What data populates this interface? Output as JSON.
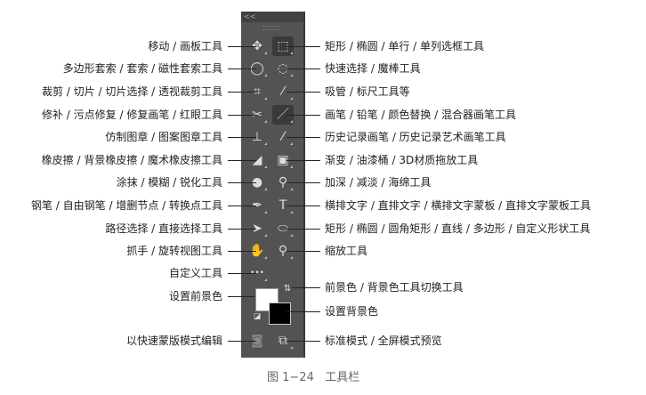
{
  "left_labels": [
    "移动 / 画板工具",
    "多边形套索 / 套索 / 磁性套索工具",
    "裁剪 / 切片 / 切片选择 / 透视裁剪工具",
    "修补 / 污点修复 / 修复画笔 / 红眼工具",
    "仿制图章 / 图案图章工具",
    "橡皮擦 / 背景橡皮擦 / 魔术橡皮擦工具",
    "涂抹 / 模糊 / 锐化工具",
    "钢笔 / 自由钢笔 / 增删节点 / 转换点工具",
    "路径选择 / 直接选择工具",
    "抓手 / 旋转视图工具",
    "自定义工具",
    "设置前景色",
    "以快速蒙版模式编辑"
  ],
  "right_labels": [
    "矩形 / 椭圆 / 单行 / 单列选框工具",
    "快速选择 / 魔棒工具",
    "吸管 / 标尺工具等",
    "画笔 / 铅笔 / 颜色替换 / 混合器画笔工具",
    "历史记录画笔 / 历史记录艺术画笔工具",
    "渐变 / 油漆桶 / 3D材质拖放工具",
    "加深 / 减淡 / 海绵工具",
    "横排文字 / 直排文字 / 横排文字蒙板 / 直排文字蒙板工具",
    "矩形 / 椭圆 / 圆角矩形 / 直线 / 多边形 / 自定义形状工具",
    "缩放工具",
    "前景色 / 背景色工具切换工具",
    "设置背景色",
    "标准模式 / 全屏模式预览"
  ],
  "left_icons": [
    "move-icon",
    "lasso-icon",
    "crop-icon",
    "patch-icon",
    "stamp-icon",
    "eraser-icon",
    "blur-icon",
    "pen-icon",
    "path-select-icon",
    "hand-icon",
    "more-icon"
  ],
  "right_icons": [
    "marquee-icon",
    "quick-select-icon",
    "eyedropper-icon",
    "brush-icon",
    "history-brush-icon",
    "gradient-icon",
    "dodge-icon",
    "type-icon",
    "ellipse-icon",
    "zoom-icon"
  ],
  "panel": {
    "collapse": "<<"
  },
  "caption": {
    "number": "图 1−24",
    "title": "工具栏"
  },
  "colors": {
    "panel": "#535353",
    "foreground": "#ffffff",
    "background": "#000000"
  }
}
